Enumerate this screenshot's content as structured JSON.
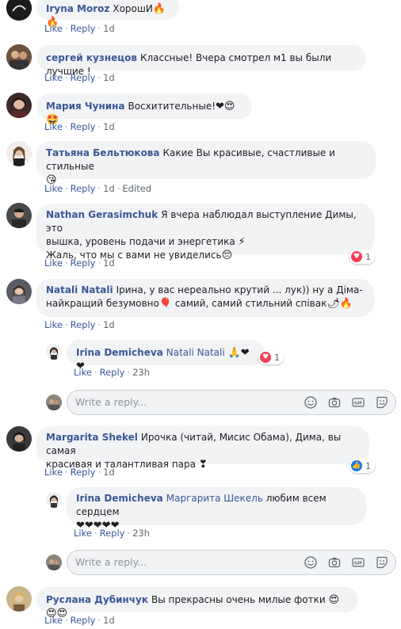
{
  "actions": {
    "like": "Like",
    "reply": "Reply",
    "edited": "Edited"
  },
  "reply_placeholder": "Write a reply...",
  "comments": [
    {
      "author": "Iryna Moroz",
      "text": "ХорошИ",
      "emoji": "🔥🔥",
      "time": "1d"
    },
    {
      "author": "сергей кузнецов",
      "text": "Классные! Вчера смотрел м1 вы были лучшие !",
      "time": "1d"
    },
    {
      "author": "Мария Чунина",
      "text": "Восхитительные!",
      "emoji": "❤😍🤩",
      "time": "1d"
    },
    {
      "author": "Татьяна Бельтюкова",
      "text": "Какие Вы красивые, счастливые и стильные",
      "emoji": "😘",
      "time": "1d"
    },
    {
      "author": "Nathan Gerasimchuk",
      "line1": "Я вчера наблюдал выступление Димы, это",
      "line2": "вышка, уровень подачи и энергетика",
      "line2_emoji": "⚡",
      "line3": "Жаль, что мы с вами не увиделись",
      "line3_emoji": "😔",
      "time": "1d",
      "reactions": "1"
    },
    {
      "author": "Natali Natali",
      "line1": "Ірина, у вас нереально крутий ... лук)) ну а Діма-",
      "line2": "найкращий безумовно",
      "line2_emoji": "🎈",
      "line2b": " самий, самий стильний співак",
      "line2b_emoji": "🌶🔥",
      "time": "1d"
    },
    {
      "author": "Margarita Shekel",
      "line1": "Ирочка (читай, Мисис Обама), Дима, вы самая",
      "line2": "красивая и талантливая пара",
      "line2_emoji": "❣",
      "time": "1d",
      "reactions": "1"
    },
    {
      "author": "Руслана Дубинчук",
      "text": "Вы прекрасны очень милые фотки",
      "emoji": "😍😍😍",
      "time": "1d"
    }
  ],
  "replies": [
    {
      "author": "Irina Demicheva",
      "mention": "Natali Natali",
      "emoji": "🙏❤❤",
      "time": "23h",
      "reactions": "1"
    },
    {
      "author": "Irina Demicheva",
      "mention": "Маргарита Шекель",
      "text": "любим всем сердцем",
      "line2_emoji": "❤❤❤❤❤",
      "time": "23h"
    }
  ]
}
